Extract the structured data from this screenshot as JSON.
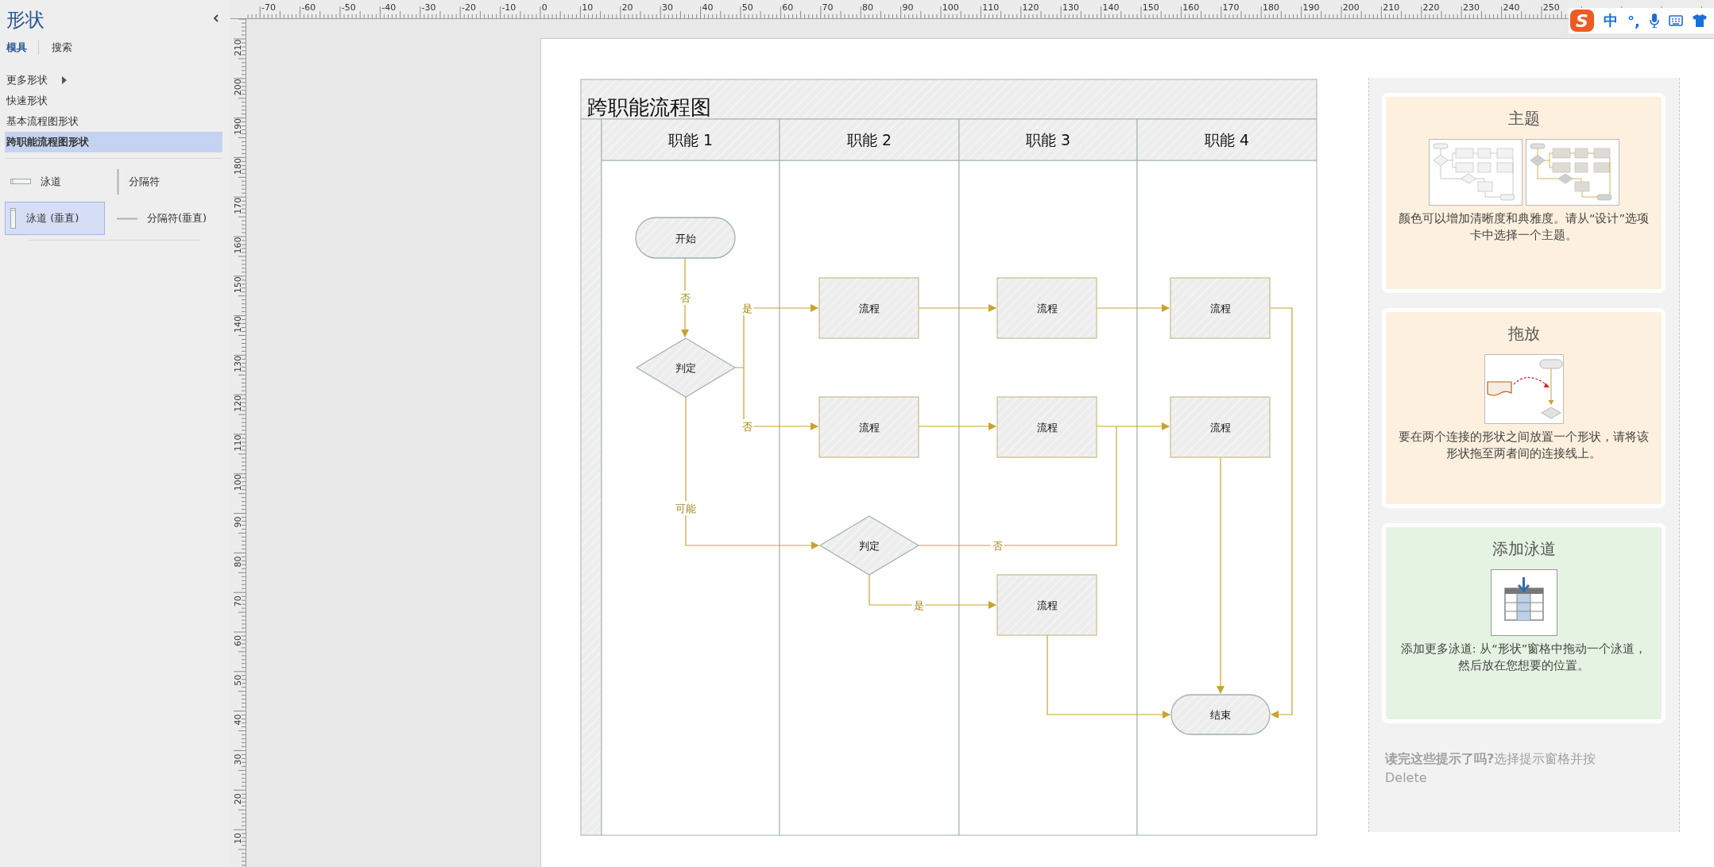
{
  "shapes_panel": {
    "title": "形状",
    "tabs": [
      {
        "label": "模具",
        "selected": true
      },
      {
        "label": "搜索",
        "selected": false
      }
    ],
    "stencils": [
      {
        "label": "更多形状",
        "submenu": true,
        "selected": false
      },
      {
        "label": "快速形状",
        "submenu": false,
        "selected": false
      },
      {
        "label": "基本流程图形状",
        "submenu": false,
        "selected": false
      },
      {
        "label": "跨职能流程图形状",
        "submenu": false,
        "selected": true
      }
    ],
    "shapes": [
      {
        "kind": "swimlane",
        "label": "泳道",
        "selected": false
      },
      {
        "kind": "separator",
        "label": "分隔符",
        "selected": false
      },
      {
        "kind": "swimlane_vertical",
        "label": "泳道 (垂直)",
        "selected": true
      },
      {
        "kind": "separator_vertical",
        "label": "分隔符(垂直)",
        "selected": false
      }
    ]
  },
  "rulers": {
    "horizontal": [
      "-70",
      "-60",
      "-50",
      "-40",
      "-30",
      "-20",
      "-10",
      "0",
      "10",
      "20",
      "30",
      "40",
      "50",
      "60",
      "70",
      "80",
      "90",
      "100",
      "110",
      "120",
      "130",
      "140",
      "150",
      "160",
      "170",
      "180",
      "190",
      "200",
      "210",
      "220",
      "230",
      "240",
      "250"
    ],
    "vertical": [
      "210",
      "200",
      "190",
      "180",
      "170",
      "160",
      "150",
      "140",
      "130",
      "120",
      "110",
      "100",
      "90",
      "80",
      "70",
      "60",
      "50",
      "40",
      "30",
      "20",
      "10"
    ]
  },
  "ime_toolbar": {
    "logo": "S",
    "mode": "中",
    "punctuation": "°,"
  },
  "diagram": {
    "title": "跨职能流程图",
    "lanes": [
      "职能 1",
      "职能 2",
      "职能 3",
      "职能 4"
    ],
    "shapes": [
      {
        "kind": "terminator",
        "label": "开始"
      },
      {
        "kind": "decision",
        "label": "判定"
      },
      {
        "kind": "process",
        "label": "流程"
      },
      {
        "kind": "process",
        "label": "流程"
      },
      {
        "kind": "process",
        "label": "流程"
      },
      {
        "kind": "process",
        "label": "流程"
      },
      {
        "kind": "process",
        "label": "流程"
      },
      {
        "kind": "process",
        "label": "流程"
      },
      {
        "kind": "decision",
        "label": "判定"
      },
      {
        "kind": "process",
        "label": "流程"
      },
      {
        "kind": "terminator",
        "label": "结束"
      }
    ],
    "connector_labels": [
      "否",
      "是",
      "否",
      "可能",
      "否",
      "是"
    ]
  },
  "tips": {
    "cards": [
      {
        "kind": "themes",
        "title": "主题",
        "text": "颜色可以增加清晰度和典雅度。请从“设计”选项卡中选择一个主题。",
        "color": "#fdf0de"
      },
      {
        "kind": "drag",
        "title": "拖放",
        "text": "要在两个连接的形状之间放置一个形状，请将该形状拖至两者间的连接线上。",
        "color": "#fdf0de"
      },
      {
        "kind": "add_lane",
        "title": "添加泳道",
        "text": "添加更多泳道: 从“形状”窗格中拖动一个泳道，然后放在您想要的位置。",
        "color": "#e5f4e2"
      }
    ],
    "footer": "**读完这些提示了吗?**选择提示窗格并按 Delete"
  }
}
